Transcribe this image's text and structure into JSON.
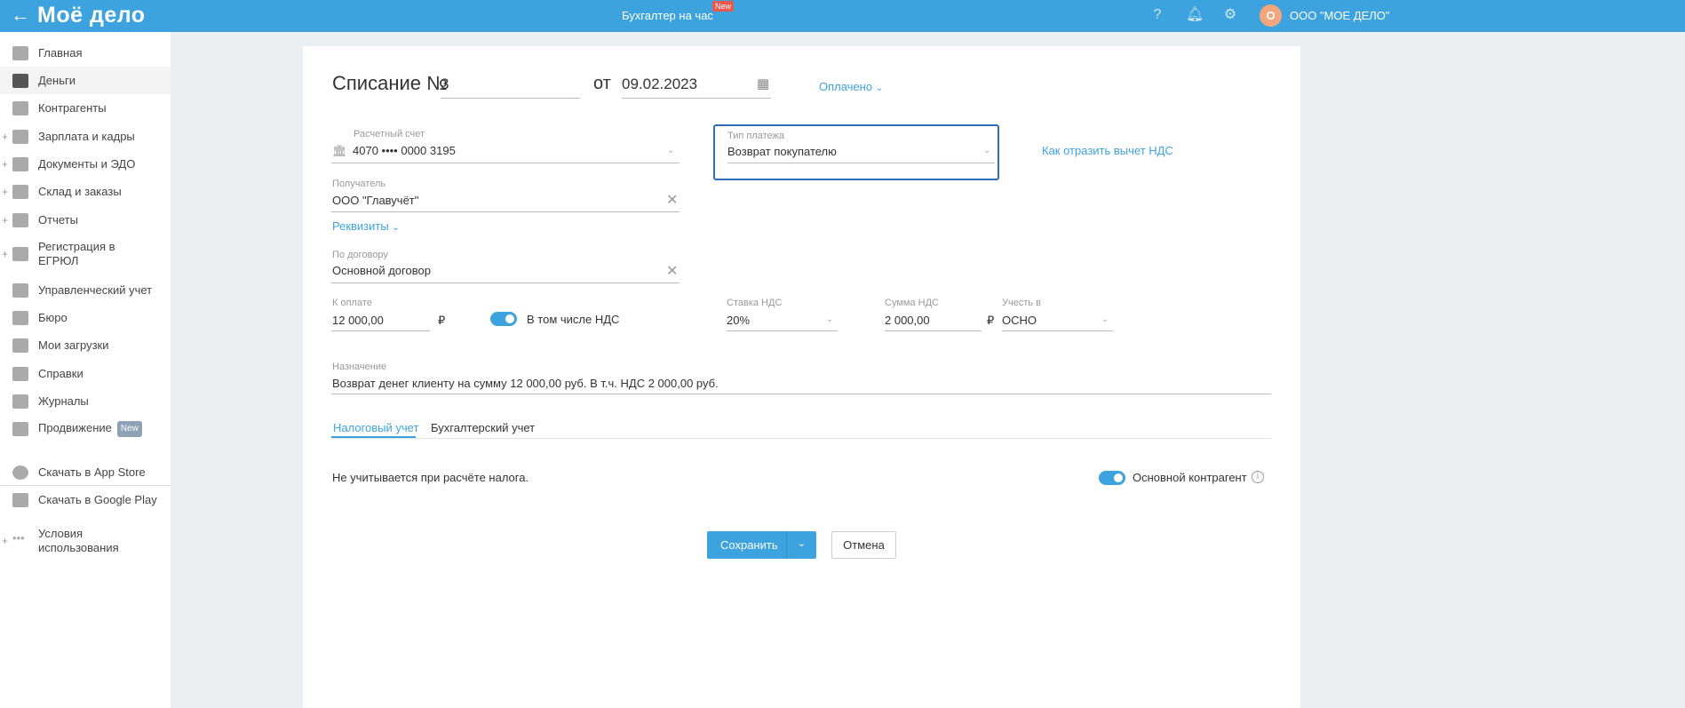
{
  "header": {
    "logo": "Моё дело",
    "title": "Бухгалтер на час",
    "title_badge": "New",
    "avatar_letter": "О",
    "org": "ООО \"МОЕ ДЕЛО\""
  },
  "sidebar": {
    "items": [
      {
        "label": "Главная"
      },
      {
        "label": "Деньги"
      },
      {
        "label": "Контрагенты"
      },
      {
        "label": "Зарплата и кадры"
      },
      {
        "label": "Документы и ЭДО"
      },
      {
        "label": "Склад и заказы"
      },
      {
        "label": "Отчеты"
      },
      {
        "label": "Регистрация в ЕГРЮЛ"
      },
      {
        "label": "Управленческий учет"
      },
      {
        "label": "Бюро"
      },
      {
        "label": "Мои загрузки"
      },
      {
        "label": "Справки"
      },
      {
        "label": "Журналы"
      },
      {
        "label": "Продвижение",
        "badge": "New"
      },
      {
        "label": "Скачать в App Store"
      },
      {
        "label": "Скачать в Google Play"
      },
      {
        "label": "Условия использования"
      }
    ]
  },
  "form": {
    "title": "Списание №",
    "number": "3",
    "date_prefix": "от",
    "date": "09.02.2023",
    "status": "Оплачено",
    "account_label": "Расчетный счет",
    "account": "4070 •••• 0000 3195",
    "payment_type_label": "Тип платежа",
    "payment_type": "Возврат покупателю",
    "vat_link": "Как отразить вычет НДС",
    "recipient_label": "Получатель",
    "recipient": "ООО \"Главучёт\"",
    "details_link": "Реквизиты",
    "contract_label": "По договору",
    "contract": "Основной договор",
    "amount_label": "К оплате",
    "amount": "12 000,00",
    "currency": "₽",
    "vat_included": "В том числе НДС",
    "vat_rate_label": "Ставка НДС",
    "vat_rate": "20%",
    "vat_sum_label": "Сумма НДС",
    "vat_sum": "2 000,00",
    "account_in_label": "Учесть в",
    "account_in": "ОСНО",
    "purpose_label": "Назначение",
    "purpose": "Возврат денег клиенту на сумму 12 000,00 руб. В т.ч. НДС 2 000,00 руб.",
    "tabs": [
      {
        "label": "Налоговый учет"
      },
      {
        "label": "Бухгалтерский учет"
      }
    ],
    "tax_note": "Не учитывается при расчёте налога.",
    "main_contractor": "Основной контрагент",
    "save": "Сохранить",
    "cancel": "Отмена"
  },
  "colors": {
    "accent": "#3ca3de",
    "focus": "#2f6fb8"
  }
}
